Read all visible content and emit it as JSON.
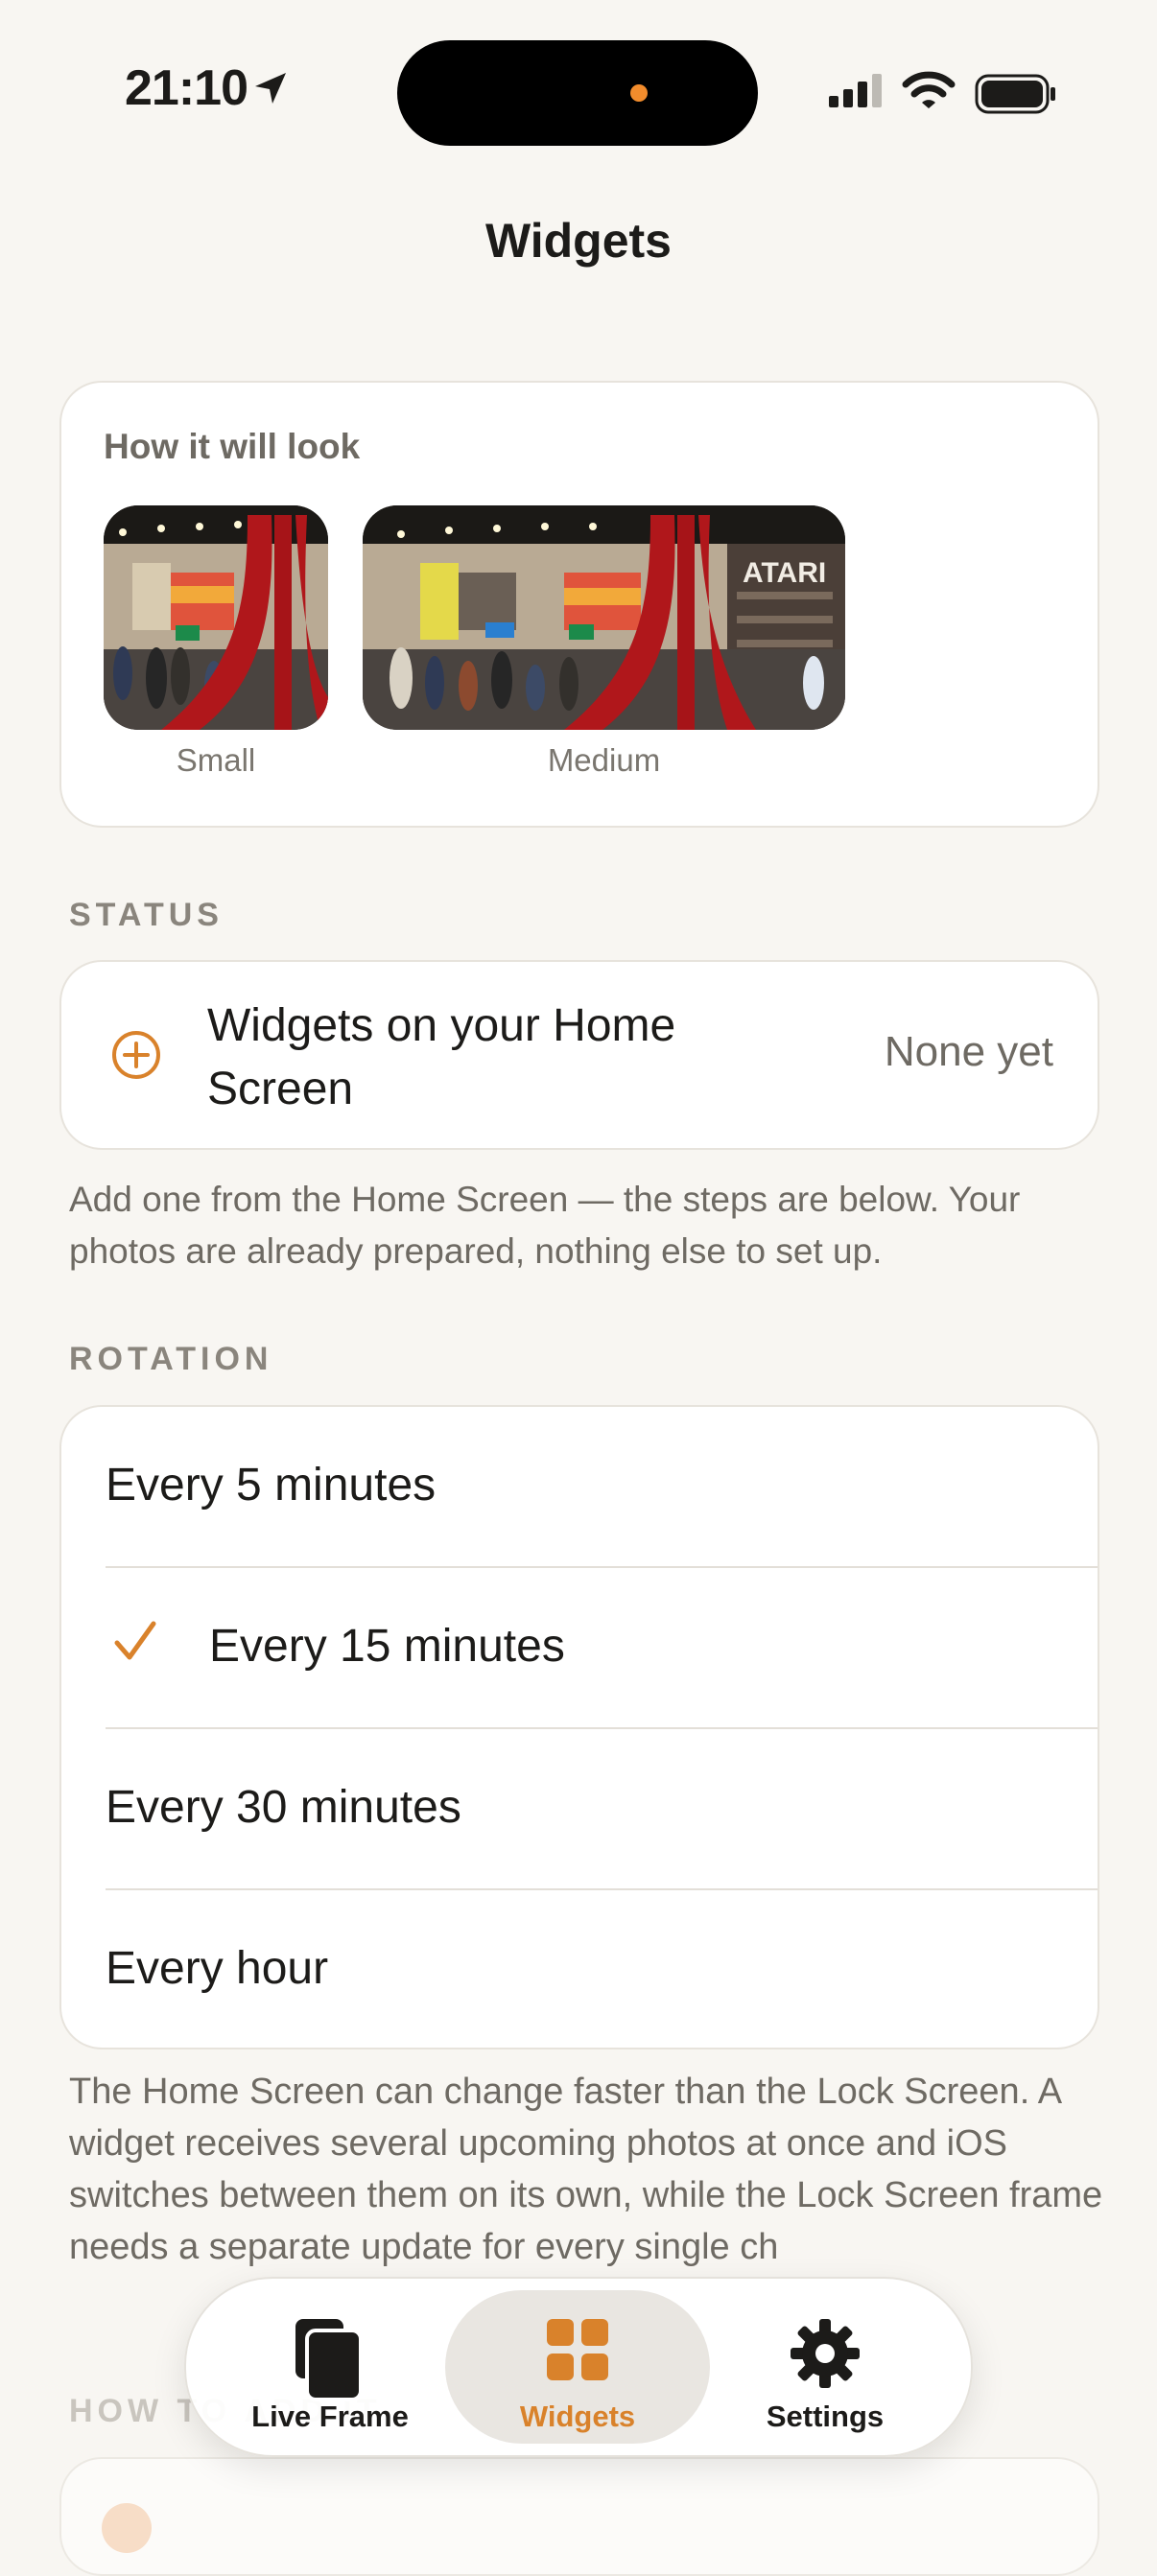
{
  "status_bar": {
    "time": "21:10"
  },
  "header": {
    "title": "Widgets"
  },
  "preview": {
    "title": "How it will look",
    "small_caption": "Small",
    "medium_caption": "Medium",
    "sign_text": "ATARI"
  },
  "status": {
    "section_label": "STATUS",
    "title": "Widgets on your Home Screen",
    "value": "None yet",
    "note": "Add one from the Home Screen — the steps are below. Your photos are already prepared, nothing else to set up."
  },
  "rotation": {
    "section_label": "ROTATION",
    "options": [
      {
        "label": "Every 5 minutes",
        "selected": false
      },
      {
        "label": "Every 15 minutes",
        "selected": true
      },
      {
        "label": "Every 30 minutes",
        "selected": false
      },
      {
        "label": "Every hour",
        "selected": false
      }
    ],
    "note": "The Home Screen can change faster than the Lock Screen. A widget receives several upcoming photos at once and iOS switches between them on its own, while the Lock Screen frame needs a separate update for every single ch"
  },
  "howto": {
    "section_label": "HOW TO ADD IT"
  },
  "tabs": [
    {
      "label": "Live Frame",
      "icon": "stacked-frames-icon",
      "active": false
    },
    {
      "label": "Widgets",
      "icon": "grid-icon",
      "active": true
    },
    {
      "label": "Settings",
      "icon": "gear-icon",
      "active": false
    }
  ],
  "colors": {
    "accent": "#d9822b",
    "background": "#f8f6f2",
    "card": "#ffffff",
    "secondary_text": "#6e6a63"
  }
}
